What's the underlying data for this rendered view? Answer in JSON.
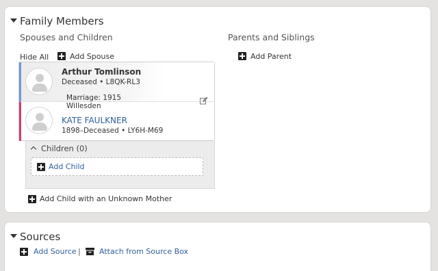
{
  "family": {
    "title": "Family Members",
    "spouses_heading": "Spouses and Children",
    "parents_heading": "Parents and Siblings",
    "hide_all": "Hide All",
    "add_spouse": "Add Spouse",
    "add_parent": "Add Parent",
    "father": {
      "name": "Arthur Tomlinson",
      "meta": "Deceased • L8QK-RL3",
      "color": "#6f9ad6"
    },
    "marriage": {
      "label": "Marriage: 1915",
      "place": "Willesden"
    },
    "mother": {
      "name": "KATE FAULKNER",
      "meta": "1898–Deceased • LY6H-M69",
      "color": "#c63f74"
    },
    "children_header": "Children (0)",
    "add_child": "Add Child",
    "add_child_unknown_mother": "Add Child with an Unknown Mother"
  },
  "sources": {
    "title": "Sources",
    "add_source": "Add Source",
    "separator": "|",
    "attach_from_box": "Attach from Source Box"
  },
  "colors": {
    "link": "#2e5f9e",
    "page_bg": "#e4e3e1"
  },
  "icons": [
    "caret-down-icon",
    "plus-icon",
    "avatar-icon",
    "edit-icon",
    "source-box-icon",
    "chevron-up-icon"
  ]
}
